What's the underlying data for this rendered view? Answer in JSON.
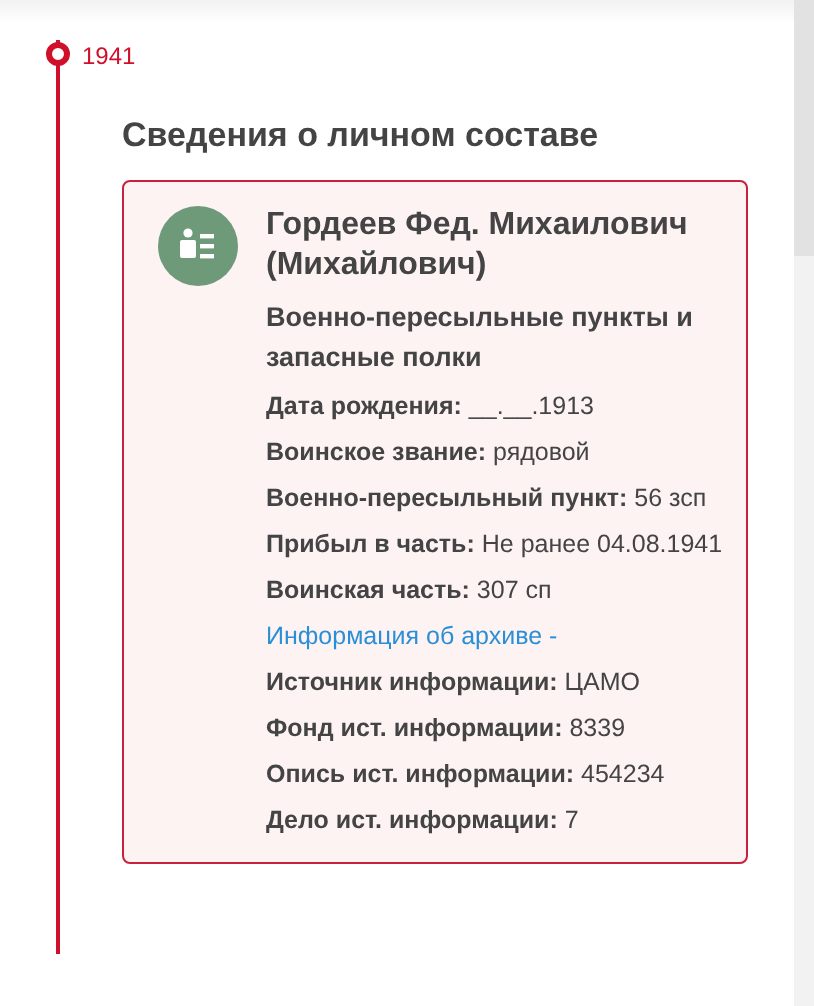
{
  "timeline": {
    "year": "1941"
  },
  "section": {
    "title": "Сведения о личном составе"
  },
  "card": {
    "name": "Гордеев Фед. Михаилович (Михайлович)",
    "category": "Военно-пересыльные пункты и запасные полки",
    "rows": [
      {
        "kind": "field",
        "label": "Дата рождения:",
        "value": "__.__.1913"
      },
      {
        "kind": "field",
        "label": "Воинское звание:",
        "value": "рядовой"
      },
      {
        "kind": "field",
        "label": "Военно-пересыльный пункт:",
        "value": "56 зсп"
      },
      {
        "kind": "field",
        "label": "Прибыл в часть:",
        "value": "Не ранее 04.08.1941"
      },
      {
        "kind": "field",
        "label": "Воинская часть:",
        "value": "307 сп"
      },
      {
        "kind": "link",
        "text": "Информация об архиве -"
      },
      {
        "kind": "field",
        "label": "Источник информации:",
        "value": "ЦАМО"
      },
      {
        "kind": "field",
        "label": "Фонд ист. информации:",
        "value": "8339"
      },
      {
        "kind": "field",
        "label": "Опись ист. информации:",
        "value": "454234"
      },
      {
        "kind": "field",
        "label": "Дело ист. информации:",
        "value": "7"
      }
    ]
  }
}
